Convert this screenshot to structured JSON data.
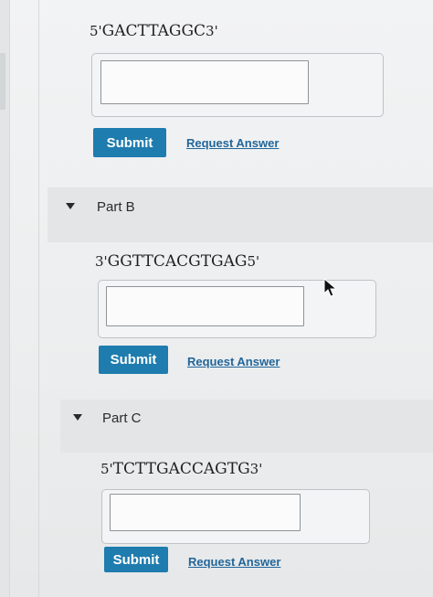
{
  "part_a": {
    "sequence": {
      "start_label": "5'",
      "bases": "GACTTAGGC",
      "end_label": "3'"
    },
    "answer_value": "",
    "submit_label": "Submit",
    "request_label": "Request Answer"
  },
  "part_b": {
    "title": "Part B",
    "sequence": {
      "start_label": "3'",
      "bases": "GGTTCACGTGAG",
      "end_label": "5'"
    },
    "answer_value": "",
    "submit_label": "Submit",
    "request_label": "Request Answer"
  },
  "part_c": {
    "title": "Part C",
    "sequence": {
      "start_label": "5'",
      "bases": "TCTTGACCAGTG",
      "end_label": "3'"
    },
    "answer_value": "",
    "submit_label": "Submit",
    "request_label": "Request Answer"
  },
  "colors": {
    "submit_bg": "#1f7cae",
    "link": "#22669a",
    "part_band": "#e3e5e6"
  },
  "icons": {
    "toggle": "caret-down-icon",
    "pointer": "mouse-pointer-icon"
  }
}
